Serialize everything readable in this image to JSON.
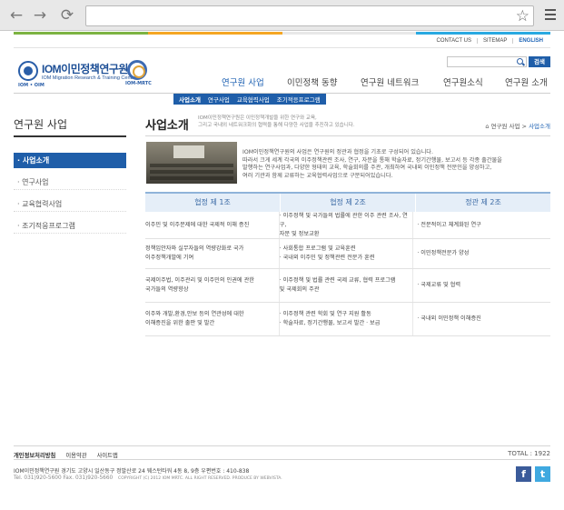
{
  "browser": {
    "back_icon": "arrow-left-icon",
    "forward_icon": "arrow-right-icon",
    "reload_icon": "reload-icon",
    "address_value": "",
    "bookmark_icon": "star-icon",
    "menu_icon": "hamburger-menu-icon"
  },
  "brand_colors": [
    "#7cb342",
    "#f5a623",
    "#e8e8e8",
    "#29a9e1"
  ],
  "util_links": {
    "contact": "CONTACT US",
    "sitemap": "SITEMAP",
    "english": "ENGLISH"
  },
  "logo": {
    "title": "IOM이민정책연구원",
    "subtitle": "IOM Migration Research & Training Centre",
    "badge_left": "IOM • OIM",
    "badge_right": "IOM-MRTC"
  },
  "search": {
    "value": "",
    "button_label": "검색"
  },
  "main_nav": [
    "연구원 사업",
    "이민정책 동향",
    "연구원 네트워크",
    "연구원소식",
    "연구원 소개"
  ],
  "sub_nav": [
    "사업소개",
    "연구사업",
    "교육협력사업",
    "조기적응프로그램"
  ],
  "lnb": {
    "title": "연구원 사업",
    "items": [
      "· 사업소개",
      "· 연구사업",
      "· 교육협력사업",
      "· 조기적응프로그램"
    ]
  },
  "content": {
    "title": "사업소개",
    "desc_line1": "IOM이민정책연구원은 이민정책개발을 위한 연구와 교육,",
    "desc_line2": "그리고 국내외 네트워크화의 협력을 통해 다양한 사업을 추진하고 있습니다.",
    "breadcrumb_home": "⌂ 연구원 사업",
    "breadcrumb_sep": " > ",
    "breadcrumb_current": "사업소개",
    "intro_lines": [
      "IOM이민정책연구원의 사업은 연구원의 정관과 협정을 기초로 구성되어 있습니다.",
      "따라서 크게 세계 각국의 이주정책관련 조사, 연구, 자문을 통해 학술자료, 정기간행물, 보고서 등 각종 출간물을",
      "발행하는 연구사업과, 다양한 형태의 교육, 학술회의를 주관, 개최하여 국내외 이민정책 전문인을 양성하고,",
      "여러 기관과 함께 교류하는 교육협력사업으로 구분되어있습니다."
    ]
  },
  "table": {
    "headers": [
      "협정 제 1조",
      "협정 제 2조",
      "정관 제 2조"
    ],
    "rows": [
      [
        [
          "이주민 및 이주문제에 대한  국제적 이해 증진"
        ],
        [
          "· 이주정책 및 국가들의 법률에 관한 이주 관련 조사,  연구,",
          "  자문 및 정보교환"
        ],
        [
          "· 전문적이고 체계화된 연구"
        ]
      ],
      [
        [
          "정책입안자와 실무자들의 역량강화로 국가",
          "이주정책개발에 기여"
        ],
        [
          "· 사회통합 프로그램 및 교육훈련",
          "· 국내외 이주민 및 정책관련 전문가 훈련"
        ],
        [
          "· 이민정책전문가 양성"
        ]
      ],
      [
        [
          "국제이주법, 이주관리 및 이주민의 인권에 관한",
          "국가들의 역량향상"
        ],
        [
          "· 이주정책 및 법률 관련 국제 교류, 협력 프로그램",
          "  및  국제회의 주관"
        ],
        [
          "· 국제교류 및 협력"
        ]
      ],
      [
        [
          "이주와 개발,환경,안보 등의 연관성에 대한",
          "이해증진을 위한 출판 및 발간"
        ],
        [
          "· 이주정책 관련 학회 및 연구 지원 활동",
          "· 학술자료, 정기간행물, 보고서 발간 · 보급"
        ],
        [
          "· 국내외 이민정책 이해증진"
        ]
      ]
    ]
  },
  "footer": {
    "links": [
      "개인정보처리방침",
      "이용약관",
      "사이트맵"
    ],
    "total": "TOTAL : 1922",
    "address": "IOM이민정책연구원    경기도 고양시 일산동구 정발산로 24 웨스턴타워 4동 8, 9층 우편번호 : 410-838",
    "tel": "Tel. 031)920-5600    Fax. 031)920-5660",
    "copyright": "COPYRIGHT (C) 2012  IOM MRTC. ALL RIGHT RESERVED. PRODUCE BY WEBVISTA.",
    "facebook_label": "f",
    "twitter_label": "t",
    "facebook_icon": "facebook-icon",
    "twitter_icon": "twitter-icon"
  }
}
